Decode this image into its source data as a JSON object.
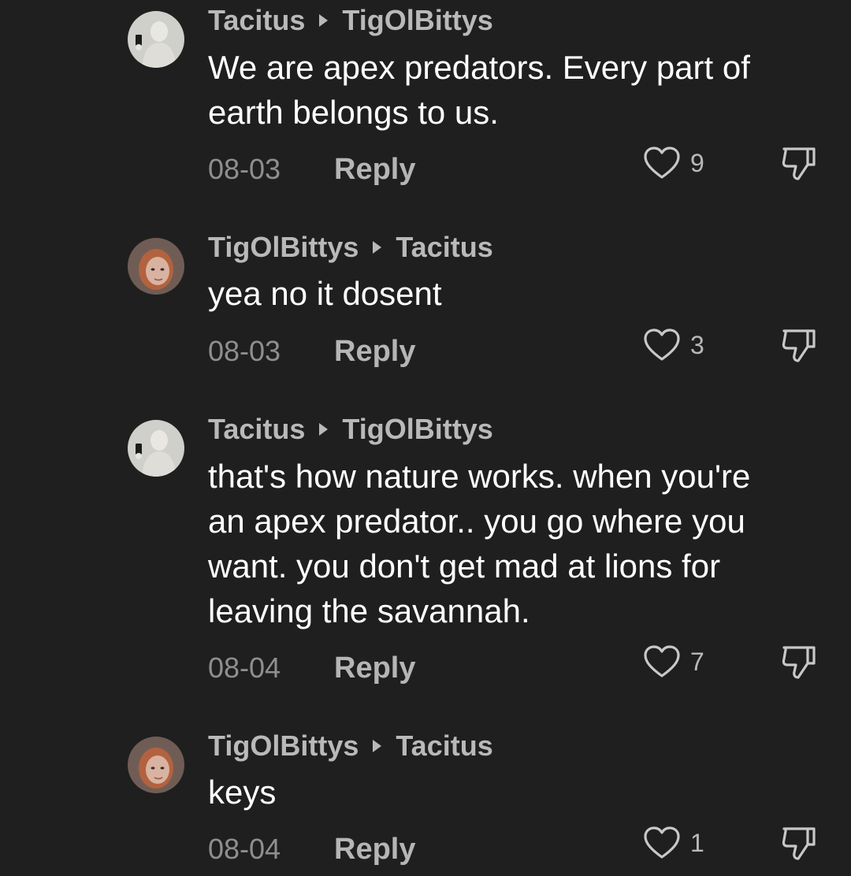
{
  "colors": {
    "background": "#1f1f1f",
    "username": "#b9b9b9",
    "body_text": "#ffffff",
    "date": "#8f8f8f",
    "reply": "#b5b5b5",
    "icon": "#c8c8c8"
  },
  "comments": [
    {
      "author": "Tacitus",
      "reply_to": "TigOlBittys",
      "avatar": "statue-avatar",
      "text": "We are apex predators. Every part of\nearth belongs to us.",
      "date": "08-03",
      "reply_label": "Reply",
      "likes": "9"
    },
    {
      "author": "TigOlBittys",
      "reply_to": "Tacitus",
      "avatar": "redhead-avatar",
      "text": "yea no it dosent",
      "date": "08-03",
      "reply_label": "Reply",
      "likes": "3"
    },
    {
      "author": "Tacitus",
      "reply_to": "TigOlBittys",
      "avatar": "statue-avatar",
      "text": "that's how nature works. when you're\nan apex predator.. you go where you\nwant. you don't get mad at lions for\nleaving the savannah.",
      "date": "08-04",
      "reply_label": "Reply",
      "likes": "7"
    },
    {
      "author": "TigOlBittys",
      "reply_to": "Tacitus",
      "avatar": "redhead-avatar",
      "text": "keys",
      "date": "08-04",
      "reply_label": "Reply",
      "likes": "1"
    }
  ]
}
